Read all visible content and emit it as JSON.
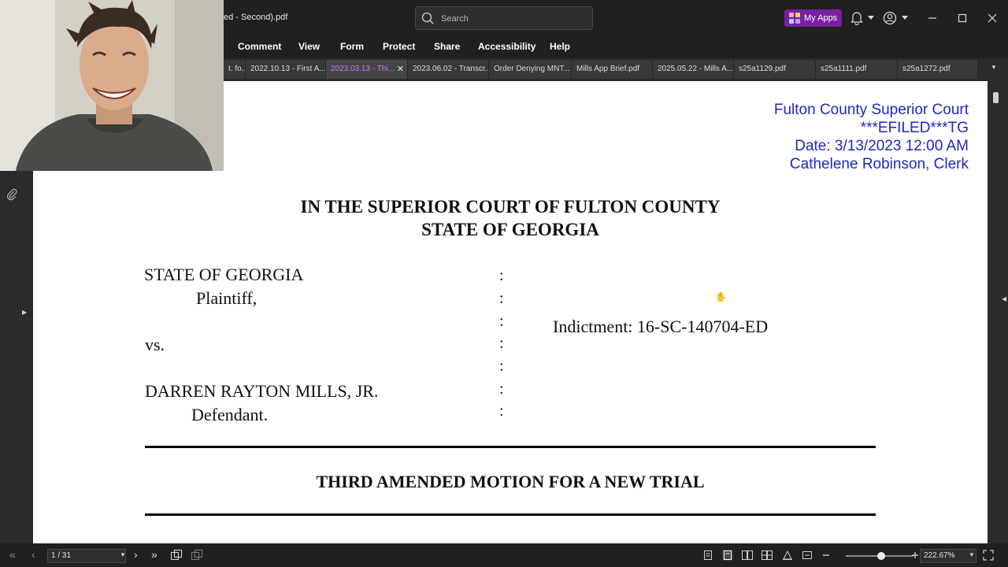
{
  "window": {
    "title": "ed - Second).pdf",
    "search_placeholder": "Search",
    "my_apps_label": "My Apps"
  },
  "menu": [
    "Comment",
    "View",
    "Form",
    "Protect",
    "Share",
    "Accessibility",
    "Help"
  ],
  "tabs": [
    {
      "label": "t. fo..."
    },
    {
      "label": "2022.10.13 - First A..."
    },
    {
      "label": "2023.03.13 - Thi...",
      "active": true
    },
    {
      "label": "2023.06.02 - Transcr..."
    },
    {
      "label": "Order Denying MNT..."
    },
    {
      "label": "Mills App Brief.pdf"
    },
    {
      "label": "2025.05.22 - Mills A..."
    },
    {
      "label": "s25a1129.pdf"
    },
    {
      "label": "s25a1111.pdf"
    },
    {
      "label": "s25a1272.pdf"
    }
  ],
  "document": {
    "stamp": [
      "Fulton County Superior Court",
      "***EFILED***TG",
      "Date: 3/13/2023 12:00 AM",
      "Cathelene Robinson, Clerk"
    ],
    "court_line1": "IN THE SUPERIOR COURT OF FULTON COUNTY",
    "court_line2": "STATE OF GEORGIA",
    "plaintiff_name": "STATE OF GEORGIA",
    "plaintiff_role": "Plaintiff,",
    "versus": "vs.",
    "defendant_name": "DARREN RAYTON MILLS, JR.",
    "defendant_role": "Defendant.",
    "colon_mark": ":",
    "indictment": "Indictment: 16-SC-140704-ED",
    "motion_title": "THIRD AMENDED MOTION FOR A NEW TRIAL"
  },
  "statusbar": {
    "page_indicator": "1 / 31",
    "zoom_level": "222.67%",
    "zoom_fraction": 0.52
  },
  "colors": {
    "accent": "#7a1fa2",
    "active_tab_text": "#c879ff",
    "stamp_text": "#1f26c2"
  },
  "icons": [
    "search-icon",
    "bell-icon",
    "account-icon",
    "minimize-icon",
    "maximize-icon",
    "close-icon",
    "attachment-icon",
    "first-page-icon",
    "prev-page-icon",
    "next-page-icon",
    "last-page-icon",
    "hand-cursor-icon"
  ]
}
